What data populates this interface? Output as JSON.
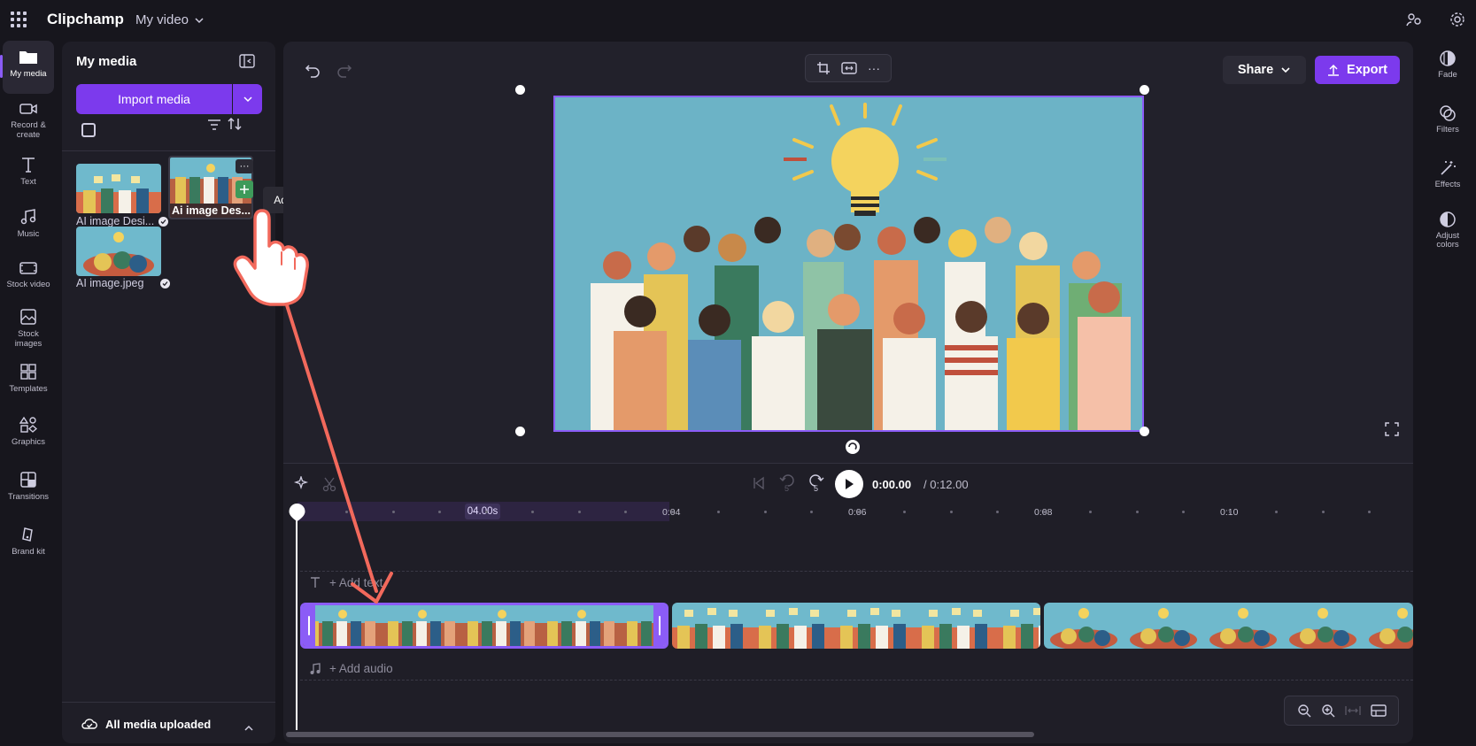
{
  "app": {
    "name": "Clipchamp",
    "project_name": "My video"
  },
  "left_rail": {
    "items": [
      {
        "label": "My media",
        "icon": "folder-icon"
      },
      {
        "label": "Record & create",
        "icon": "camera-icon"
      },
      {
        "label": "Text",
        "icon": "text-icon"
      },
      {
        "label": "Music",
        "icon": "music-icon"
      },
      {
        "label": "Stock video",
        "icon": "film-icon"
      },
      {
        "label": "Stock images",
        "icon": "image-icon"
      },
      {
        "label": "Templates",
        "icon": "templates-icon"
      },
      {
        "label": "Graphics",
        "icon": "shapes-icon"
      },
      {
        "label": "Transitions",
        "icon": "transitions-icon"
      },
      {
        "label": "Brand kit",
        "icon": "brand-icon"
      }
    ]
  },
  "media_panel": {
    "title": "My media",
    "import_label": "Import media",
    "items": [
      {
        "label": "AI image Desi..."
      },
      {
        "label": "Ai image Des..."
      },
      {
        "label": "AI image.jpeg"
      }
    ],
    "tooltip": "Add to timeline",
    "footer": "All media uploaded"
  },
  "toolbar": {
    "share_label": "Share",
    "export_label": "Export"
  },
  "right_rail": {
    "items": [
      {
        "label": "Fade",
        "icon": "fade-icon"
      },
      {
        "label": "Filters",
        "icon": "filters-icon"
      },
      {
        "label": "Effects",
        "icon": "effects-icon"
      },
      {
        "label": "Adjust colors",
        "icon": "adjust-colors-icon"
      }
    ]
  },
  "timeline": {
    "current_time": "0:00.00",
    "total_time": "/ 0:12.00",
    "selection_duration": "04.00s",
    "ticks": [
      "0:04",
      "0:06",
      "0:08",
      "0:10"
    ],
    "add_text": "+ Add text",
    "add_audio": "+ Add audio",
    "rewind_label": "5",
    "forward_label": "5"
  },
  "colors": {
    "accent": "#7c3aed",
    "selection": "#8b5cf6",
    "annotation_arrow": "#f2695c"
  }
}
